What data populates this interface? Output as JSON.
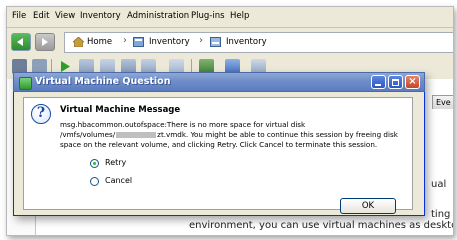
{
  "menu": [
    "File",
    "Edit",
    "View",
    "Inventory",
    "Administration",
    "Plug-ins",
    "Help"
  ],
  "breadcrumb": {
    "home": "Home",
    "item1": "Inventory",
    "item2": "Inventory"
  },
  "background": {
    "right_tab": "Eve",
    "frag1": "ual",
    "frag2": "ting",
    "frag3": "environment, you can use virtual machines as desktop o"
  },
  "dialog": {
    "title": "Virtual Machine Question",
    "heading": "Virtual Machine Message",
    "line1": "msg.hbacommon.outofspace:There is no more space for virtual disk",
    "line2_prefix": "/vmfs/volumes/",
    "line2_suffix": "zt.vmdk. You might be able to continue this session by freeing disk",
    "line3": "space on the relevant volume, and clicking Retry. Click Cancel to terminate this session.",
    "options": [
      {
        "label": "Retry",
        "selected": true
      },
      {
        "label": "Cancel",
        "selected": false
      }
    ],
    "ok_label": "OK"
  },
  "colors": {
    "title_bar": "#6f8ec8",
    "dialog_bg": "#ece9d8",
    "close": "#c4452a"
  }
}
